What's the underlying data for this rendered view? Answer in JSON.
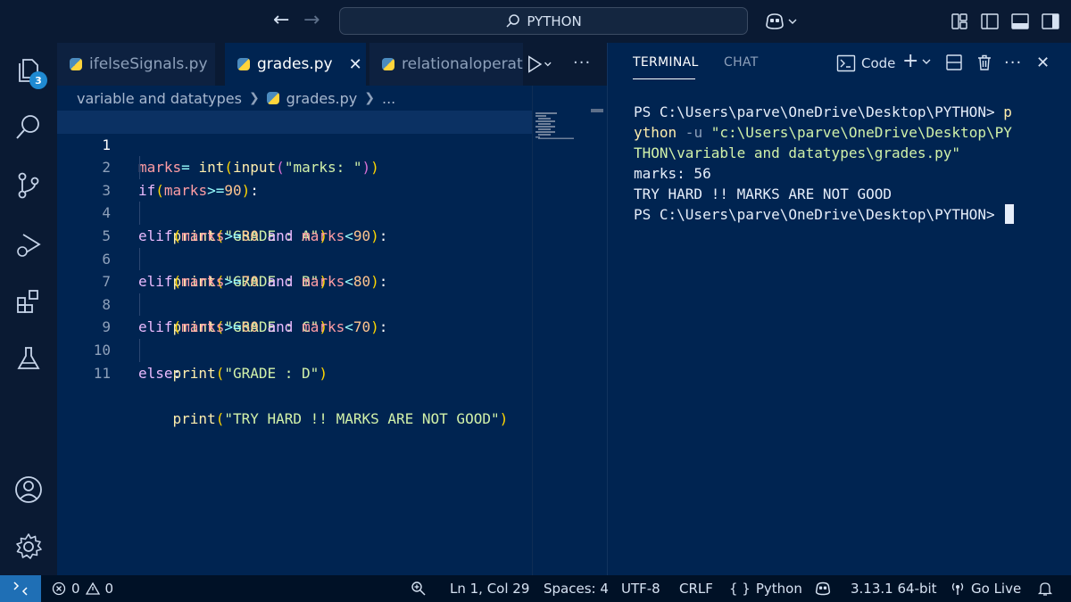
{
  "titlebar": {
    "search_text": "PYTHON"
  },
  "activity": {
    "explorer_badge": "3"
  },
  "tabs": [
    {
      "label": "ifelseSignals.py"
    },
    {
      "label": "grades.py"
    },
    {
      "label": "relationaloperato"
    }
  ],
  "breadcrumb": {
    "folder": "variable and datatypes",
    "file": "grades.py",
    "more": "..."
  },
  "code": {
    "line_numbers": [
      "1",
      "2",
      "3",
      "4",
      "5",
      "6",
      "7",
      "8",
      "9",
      "10",
      "11"
    ],
    "tokens": {
      "marks": "marks",
      "eq": "=",
      "int": "int",
      "input": "input",
      "open": "(",
      "close": ")",
      "prompt": "\"marks: \"",
      "if": "if",
      "elif": "elif",
      "else": "else",
      "and": "and",
      "colon": ":",
      "ge": ">=",
      "lt": "<",
      "print": "print",
      "n90": "90",
      "n80": "80",
      "n70": "70",
      "n60": "60",
      "gA": "\"GRADE : A\"",
      "gB": "\"GRADE : B\"",
      "gC": "\"GRADE : C\"",
      "gD": "\"GRADE : D\"",
      "fail": "\"TRY HARD !! MARKS ARE NOT GOOD\""
    }
  },
  "panel": {
    "tab_terminal": "TERMINAL",
    "tab_chat": "CHAT",
    "terminal_name": "Code"
  },
  "terminal": {
    "line1_prompt": "PS C:\\Users\\parve\\OneDrive\\Desktop\\PYTHON> ",
    "line1_exe_a": "p",
    "line2_exe_b": "ython",
    "line2_flag": " -u ",
    "line2_str": "\"c:\\Users\\parve\\OneDrive\\Desktop\\PY",
    "line3_str": "THON\\variable and datatypes\\grades.py\"",
    "line4": "marks: 56",
    "line5": "TRY HARD !! MARKS ARE NOT GOOD",
    "line6_prompt": "PS C:\\Users\\parve\\OneDrive\\Desktop\\PYTHON> "
  },
  "status": {
    "errors": "0",
    "warnings": "0",
    "position": "Ln 1, Col 29",
    "spaces": "Spaces: 4",
    "encoding": "UTF-8",
    "eol": "CRLF",
    "language_icon": "{ }",
    "language": "Python",
    "interpreter": "3.13.1 64-bit",
    "golive": "Go Live"
  },
  "colors": {
    "editor_bg": "#002451",
    "chrome_bg": "#0a1a33",
    "status_bg": "#001126",
    "remote_bg": "#1f6fb5",
    "badge": "#1f8ad2"
  }
}
